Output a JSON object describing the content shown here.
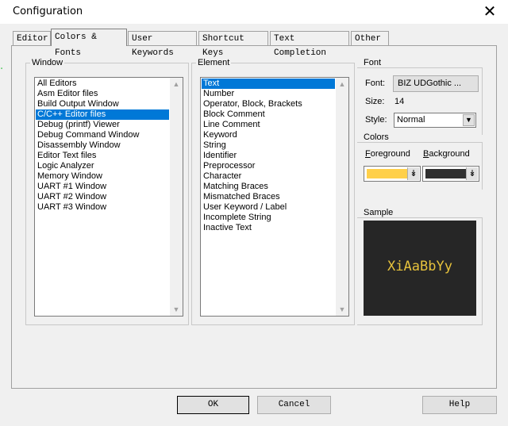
{
  "window": {
    "title": "Configuration"
  },
  "tabs": [
    "Editor",
    "Colors & Fonts",
    "User Keywords",
    "Shortcut Keys",
    "Text Completion",
    "Other"
  ],
  "window_group": {
    "legend": "Window",
    "items": [
      "All Editors",
      "Asm Editor files",
      "Build Output Window",
      "C/C++ Editor files",
      "Debug (printf) Viewer",
      "Debug Command Window",
      "Disassembly Window",
      "Editor Text files",
      "Logic Analyzer",
      "Memory Window",
      "UART #1 Window",
      "UART #2 Window",
      "UART #3 Window"
    ],
    "selected": "C/C++ Editor files"
  },
  "element_group": {
    "legend": "Element",
    "items": [
      "Text",
      "Number",
      "Operator, Block, Brackets",
      "Block Comment",
      "Line Comment",
      "Keyword",
      "String",
      "Identifier",
      "Preprocessor",
      "Character",
      "Matching Braces",
      "Mismatched Braces",
      "User Keyword / Label",
      "Incomplete String",
      "Inactive Text"
    ],
    "selected": "Text"
  },
  "font_group": {
    "legend": "Font",
    "font_label": "Font:",
    "font_button": "BIZ UDGothic ...",
    "size_label": "Size:",
    "size_value": "14",
    "style_label": "Style:",
    "style_value": "Normal"
  },
  "colors_group": {
    "legend": "Colors",
    "foreground_label": "Foreground",
    "background_label": "Background",
    "foreground_color": "#ffd04a",
    "background_color": "#303030"
  },
  "sample_group": {
    "legend": "Sample",
    "text": "XiAaBbYy",
    "text_color": "#e6c23c"
  },
  "buttons": {
    "ok": "OK",
    "cancel": "Cancel",
    "help": "Help"
  }
}
